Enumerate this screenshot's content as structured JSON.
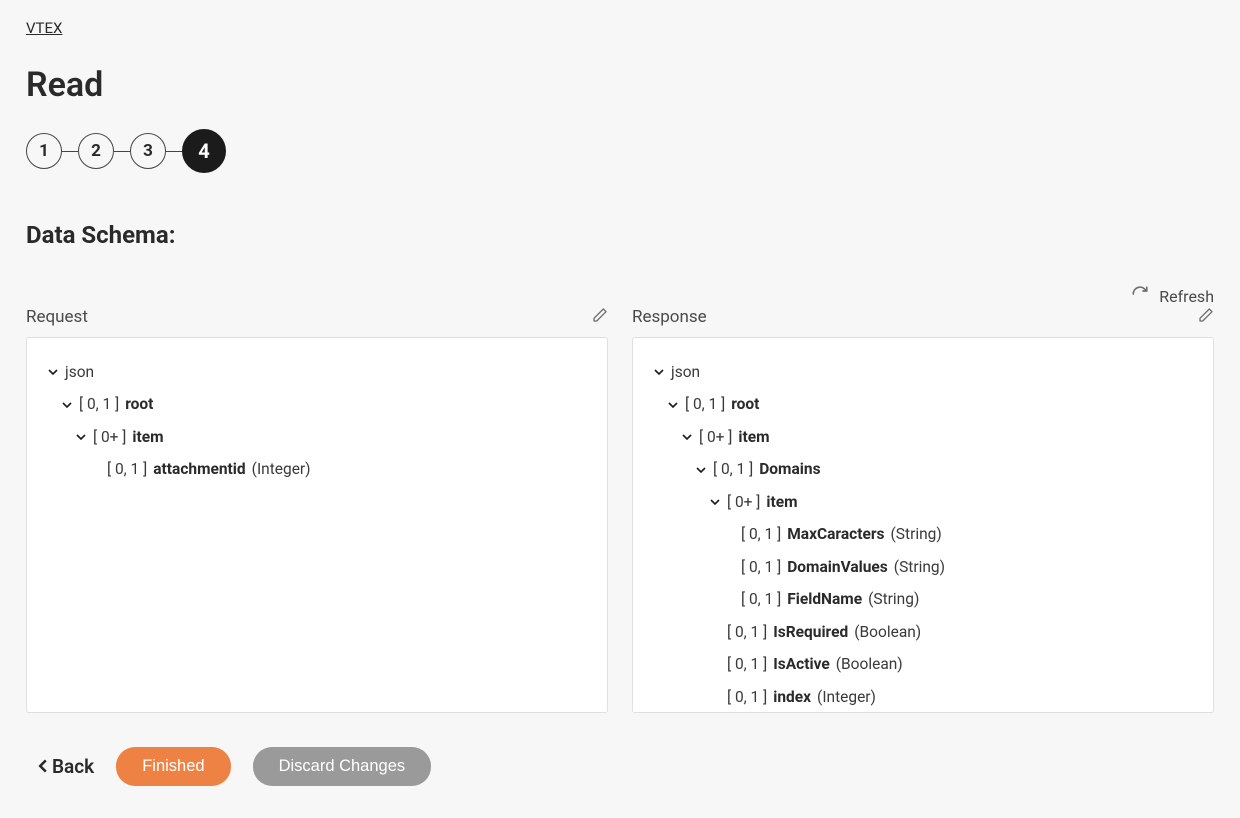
{
  "breadcrumb": "VTEX",
  "title": "Read",
  "steps": [
    "1",
    "2",
    "3",
    "4"
  ],
  "active_step_index": 3,
  "section_heading": "Data Schema:",
  "refresh_label": "Refresh",
  "panels": {
    "request": {
      "label": "Request"
    },
    "response": {
      "label": "Response"
    }
  },
  "tree_labels": {
    "json": "json",
    "root_card": "[ 0, 1 ]",
    "root_name": "root",
    "item_plus_card": "[ 0+ ]",
    "item_name": "item",
    "zero_one_card": "[ 0, 1 ]",
    "attachmentid_name": "attachmentid",
    "attachmentid_type": "(Integer)",
    "domains_name": "Domains",
    "maxcaracters_name": "MaxCaracters",
    "string_type": "(String)",
    "domainvalues_name": "DomainValues",
    "fieldname_name": "FieldName",
    "isrequired_name": "IsRequired",
    "boolean_type": "(Boolean)",
    "isactive_name": "IsActive",
    "index_name": "index",
    "integer_type": "(Integer)"
  },
  "footer": {
    "back": "Back",
    "finished": "Finished",
    "discard": "Discard Changes"
  }
}
